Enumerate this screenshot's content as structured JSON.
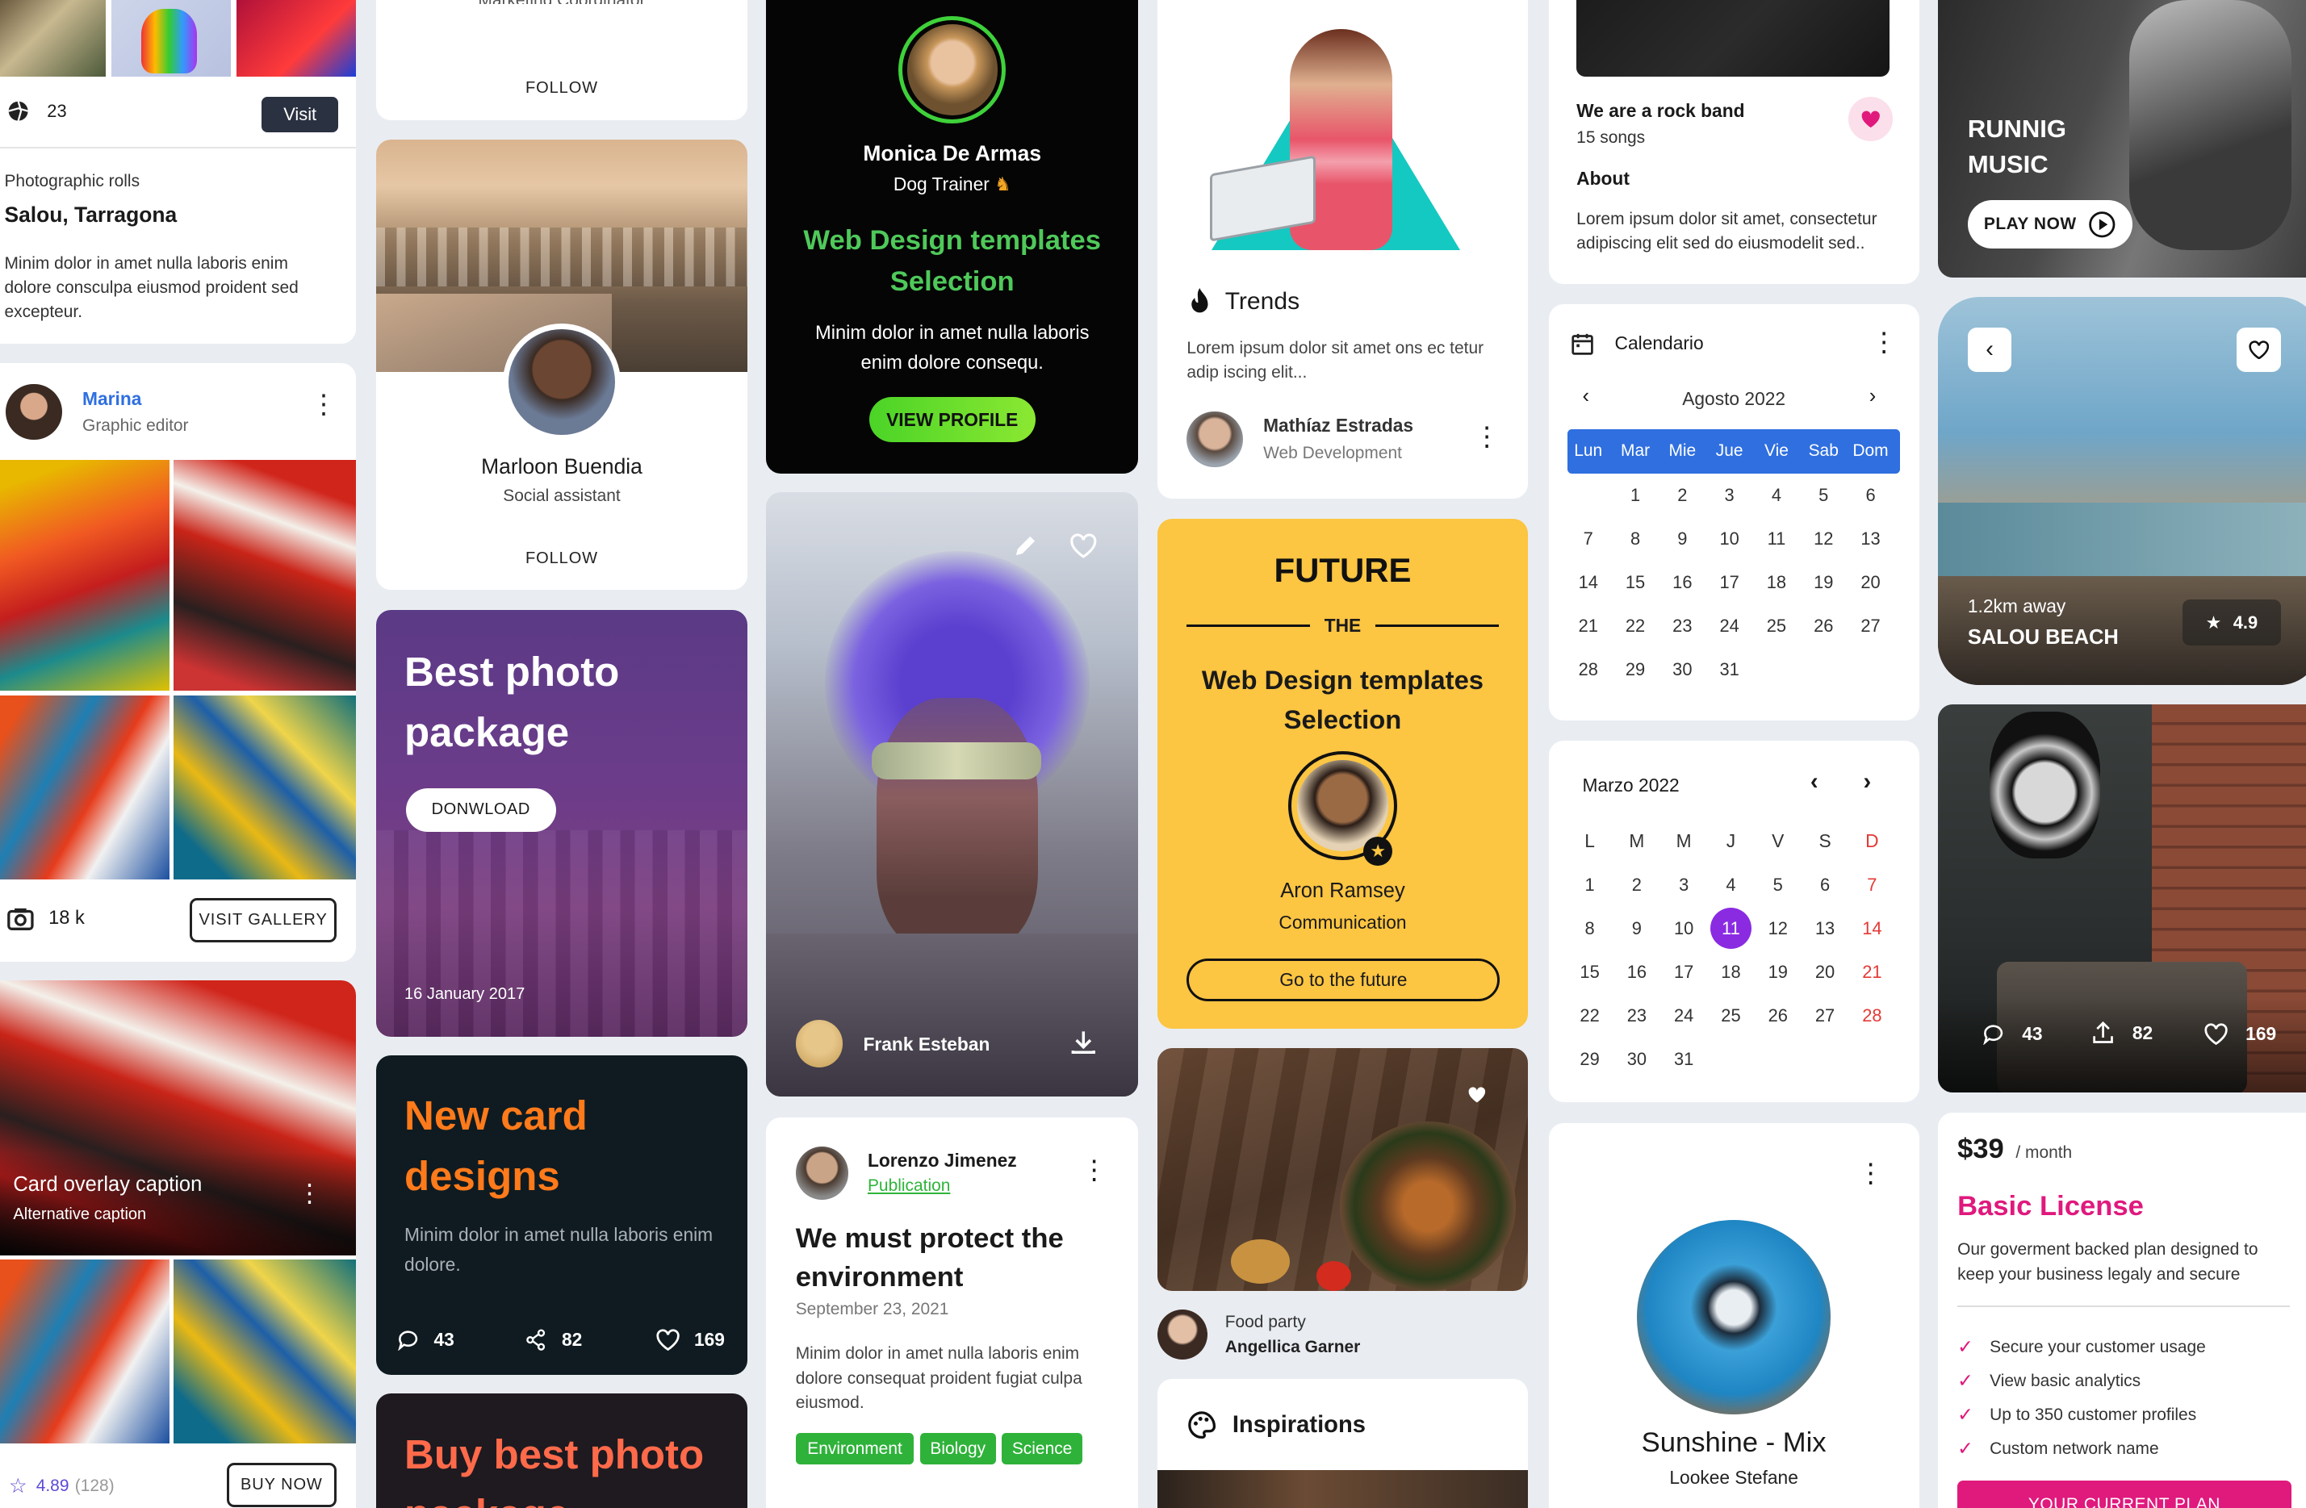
{
  "col1": {
    "post": {
      "count": "23",
      "visit_label": "Visit"
    },
    "photo": {
      "category": "Photographic rolls",
      "title": "Salou, Tarragona",
      "text": "Minim dolor in amet nulla laboris enim dolore consculpa eiusmod proident sed excepteur."
    },
    "gallery": {
      "name": "Marina",
      "role": "Graphic editor",
      "count": "18 k",
      "button": "VISIT GALLERY"
    },
    "overlay": {
      "title": "Card overlay caption",
      "subtitle": "Alternative caption",
      "rating": "4.89",
      "reviews": "(128)",
      "button": "BUY NOW"
    }
  },
  "col2": {
    "follow_top": {
      "role": "Marketing Coordinator",
      "button": "FOLLOW"
    },
    "profile": {
      "name": "Marloon Buendia",
      "role": "Social assistant",
      "button": "FOLLOW"
    },
    "photo_package": {
      "title": "Best photo package",
      "button": "DONWLOAD",
      "date": "16 January 2017"
    },
    "new_card": {
      "title": "New card designs",
      "text": "Minim dolor in amet nulla laboris enim dolore.",
      "comments": "43",
      "shares": "82",
      "likes": "169"
    },
    "buy_card": {
      "title": "Buy best photo package"
    }
  },
  "col3": {
    "trainer": {
      "name": "Monica De Armas",
      "role": "Dog Trainer",
      "title": "Web Design templates Selection",
      "text": "Minim dolor in amet nulla laboris enim dolore consequ.",
      "button": "VIEW PROFILE"
    },
    "photo_person": {
      "name": "Frank Esteban"
    },
    "article": {
      "author": "Lorenzo Jimenez",
      "tag": "Publication",
      "title": "We must protect the environment",
      "date": "September 23, 2021",
      "text": "Minim dolor in amet nulla laboris enim dolore consequat proident fugiat culpa eiusmod.",
      "chips": [
        "Environment",
        "Biology",
        "Science"
      ]
    }
  },
  "col4": {
    "trends": {
      "title": "Trends",
      "text": "Lorem ipsum dolor sit amet ons ec tetur adip iscing elit...",
      "author": "Mathíaz Estradas",
      "role": "Web Development"
    },
    "future": {
      "title": "FUTURE",
      "the": "THE",
      "heading": "Web Design templates Selection",
      "name": "Aron Ramsey",
      "role": "Communication",
      "button": "Go to the future"
    },
    "food": {
      "category": "Food party",
      "author": "Angellica Garner"
    },
    "inspirations": {
      "title": "Inspirations"
    }
  },
  "col5": {
    "band": {
      "title": "We are a rock band",
      "songs": "15 songs",
      "about_label": "About",
      "about": "Lorem ipsum dolor sit amet, consectetur adipiscing elit sed do eiusmodelit sed.."
    },
    "calendario": {
      "title": "Calendario",
      "month": "Agosto 2022",
      "days": [
        "Lun",
        "Mar",
        "Mie",
        "Jue",
        "Vie",
        "Sab",
        "Dom"
      ],
      "weeks": [
        [
          "",
          "1",
          "2",
          "3",
          "4",
          "5",
          "6"
        ],
        [
          "7",
          "8",
          "9",
          "10",
          "11",
          "12",
          "13"
        ],
        [
          "14",
          "15",
          "16",
          "17",
          "18",
          "19",
          "20"
        ],
        [
          "21",
          "22",
          "23",
          "24",
          "25",
          "26",
          "27"
        ],
        [
          "28",
          "29",
          "30",
          "31",
          "",
          "",
          ""
        ]
      ]
    },
    "marzo": {
      "month": "Marzo 2022",
      "days": [
        "L",
        "M",
        "M",
        "J",
        "V",
        "S",
        "D"
      ],
      "weeks": [
        [
          "1",
          "2",
          "3",
          "4",
          "5",
          "6",
          "7"
        ],
        [
          "8",
          "9",
          "10",
          "11",
          "12",
          "13",
          "14"
        ],
        [
          "15",
          "16",
          "17",
          "18",
          "19",
          "20",
          "21"
        ],
        [
          "22",
          "23",
          "24",
          "25",
          "26",
          "27",
          "28"
        ],
        [
          "29",
          "30",
          "31",
          "",
          "",
          "",
          ""
        ]
      ],
      "selected": "11"
    },
    "music": {
      "title": "Sunshine - Mix",
      "artist": "Lookee Stefane"
    }
  },
  "col6": {
    "running": {
      "title": "RUNNIG MUSIC",
      "button": "PLAY NOW"
    },
    "beach": {
      "distance": "1.2km away",
      "name": "SALOU BEACH",
      "rating": "4.9"
    },
    "street": {
      "comments": "43",
      "shares": "82",
      "likes": "169"
    },
    "pricing": {
      "price": "$39",
      "period": "/ month",
      "plan": "Basic License",
      "text": "Our goverment backed plan designed to keep your business legaly and secure",
      "features": [
        "Secure your customer usage",
        "View basic analytics",
        "Up to 350 customer profiles",
        "Custom network name"
      ],
      "button": "YOUR CURRENT PLAN"
    }
  },
  "colors": {
    "accent_green": "#2ec73c",
    "blue": "#2f6fe0",
    "purple": "#8a2be2",
    "yellow": "#fcc542",
    "pink": "#e0197d",
    "orange": "#ff7a1a"
  }
}
